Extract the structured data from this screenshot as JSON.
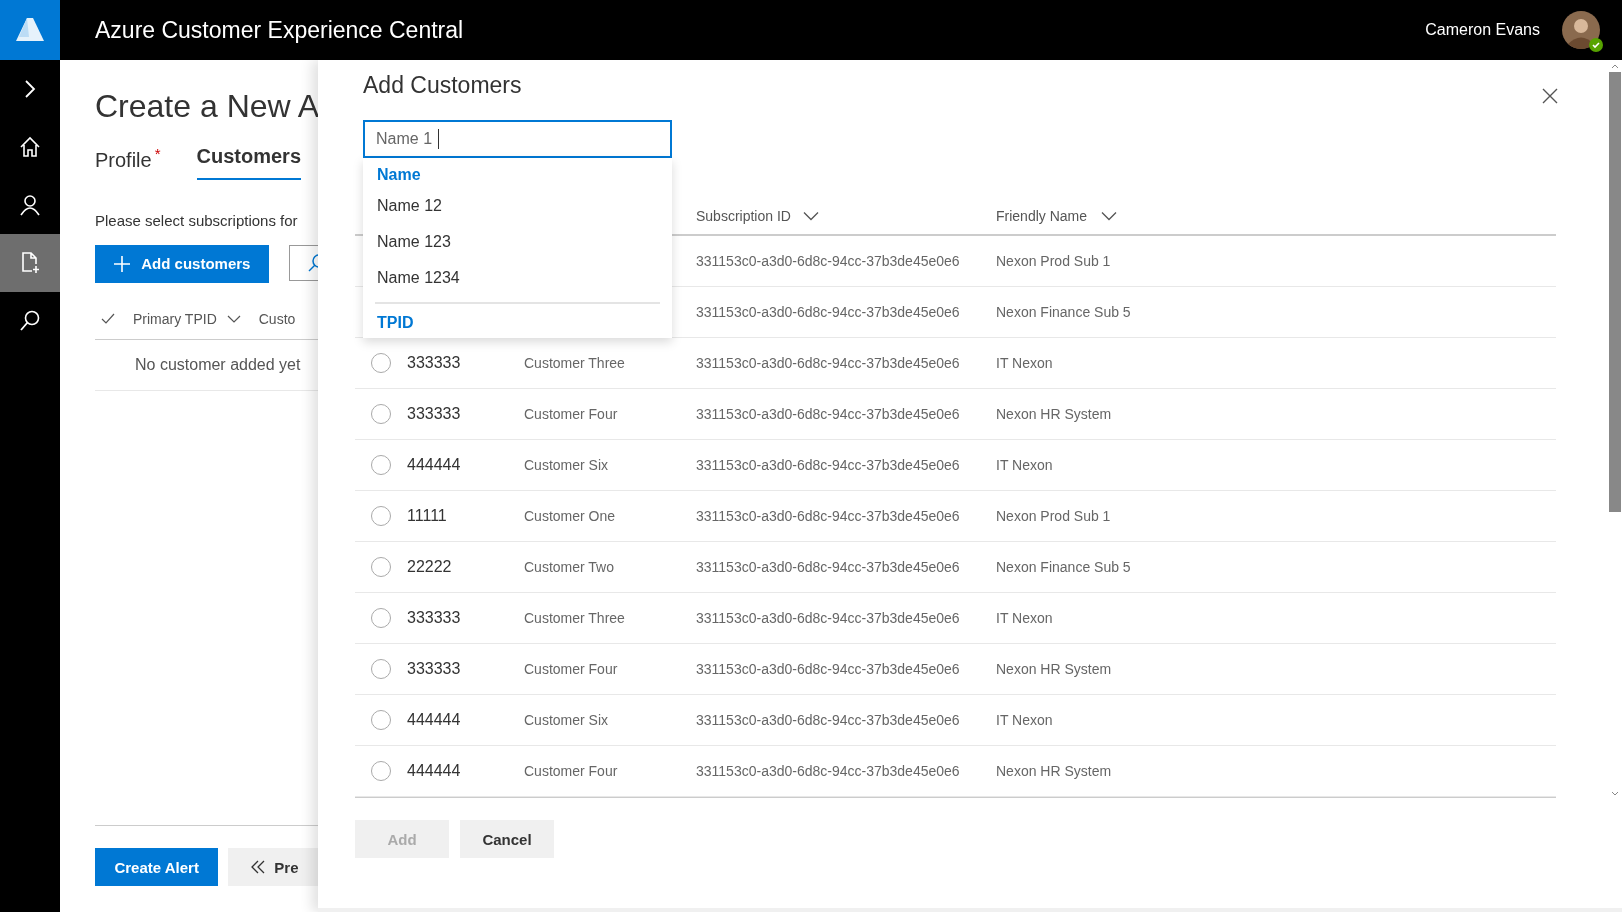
{
  "header": {
    "title": "Azure Customer Experience Central",
    "user_name": "Cameron Evans",
    "user_online": true
  },
  "rail": [
    {
      "selected": false
    },
    {
      "selected": false
    },
    {
      "selected": false
    },
    {
      "selected": true
    },
    {
      "selected": false
    }
  ],
  "page": {
    "title": "Create a New A",
    "tabs": [
      {
        "label": "Profile",
        "required_mark": "*",
        "selected": false
      },
      {
        "label": "Customers",
        "selected": true
      }
    ],
    "instruction": "Please select subscriptions for",
    "add_button": "Add customers",
    "columns": [
      {
        "label": "Primary TPID"
      },
      {
        "label": "Custo"
      }
    ],
    "empty_text": "No customer added yet",
    "footer_buttons": [
      {
        "kind": "primary",
        "label": "Create Alert"
      },
      {
        "kind": "back",
        "label": "Pre"
      }
    ]
  },
  "panel": {
    "title": "Add Customers",
    "search": {
      "value": "Name 1",
      "focused": true
    },
    "suggestions": [
      {
        "kind": "header",
        "text": "Name"
      },
      {
        "kind": "item",
        "text": "Name 12"
      },
      {
        "kind": "item",
        "text": "Name 123"
      },
      {
        "kind": "item",
        "text": "Name 1234"
      },
      {
        "kind": "divider"
      },
      {
        "kind": "header",
        "text": "TPID"
      }
    ],
    "columns": [
      {
        "label": "Subscription ID"
      },
      {
        "label": "Friendly Name"
      }
    ],
    "rows": [
      {
        "subscription_id": "331153c0-a3d0-6d8c-94cc-37b3de45e0e6",
        "friendly_name": "Nexon Prod Sub 1"
      },
      {
        "subscription_id": "331153c0-a3d0-6d8c-94cc-37b3de45e0e6",
        "friendly_name": "Nexon Finance Sub 5"
      },
      {
        "selected": false,
        "tpid": "333333",
        "customer": "Customer Three",
        "subscription_id": "331153c0-a3d0-6d8c-94cc-37b3de45e0e6",
        "friendly_name": "IT Nexon"
      },
      {
        "selected": false,
        "tpid": "333333",
        "customer": "Customer Four",
        "subscription_id": "331153c0-a3d0-6d8c-94cc-37b3de45e0e6",
        "friendly_name": "Nexon HR System"
      },
      {
        "selected": false,
        "tpid": "444444",
        "customer": "Customer Six",
        "subscription_id": "331153c0-a3d0-6d8c-94cc-37b3de45e0e6",
        "friendly_name": "IT Nexon"
      },
      {
        "selected": false,
        "tpid": "11111",
        "customer": "Customer One",
        "subscription_id": "331153c0-a3d0-6d8c-94cc-37b3de45e0e6",
        "friendly_name": "Nexon Prod Sub 1"
      },
      {
        "selected": false,
        "tpid": "22222",
        "customer": "Customer Two",
        "subscription_id": "331153c0-a3d0-6d8c-94cc-37b3de45e0e6",
        "friendly_name": "Nexon Finance Sub 5"
      },
      {
        "selected": false,
        "tpid": "333333",
        "customer": "Customer Three",
        "subscription_id": "331153c0-a3d0-6d8c-94cc-37b3de45e0e6",
        "friendly_name": "IT Nexon"
      },
      {
        "selected": false,
        "tpid": "333333",
        "customer": "Customer Four",
        "subscription_id": "331153c0-a3d0-6d8c-94cc-37b3de45e0e6",
        "friendly_name": "Nexon HR System"
      },
      {
        "selected": false,
        "tpid": "444444",
        "customer": "Customer Six",
        "subscription_id": "331153c0-a3d0-6d8c-94cc-37b3de45e0e6",
        "friendly_name": "IT Nexon"
      },
      {
        "selected": false,
        "tpid": "444444",
        "customer": "Customer Four",
        "subscription_id": "331153c0-a3d0-6d8c-94cc-37b3de45e0e6",
        "friendly_name": "Nexon HR System"
      }
    ],
    "buttons": [
      {
        "label": "Add",
        "disabled": true
      },
      {
        "label": "Cancel",
        "disabled": false
      }
    ]
  }
}
